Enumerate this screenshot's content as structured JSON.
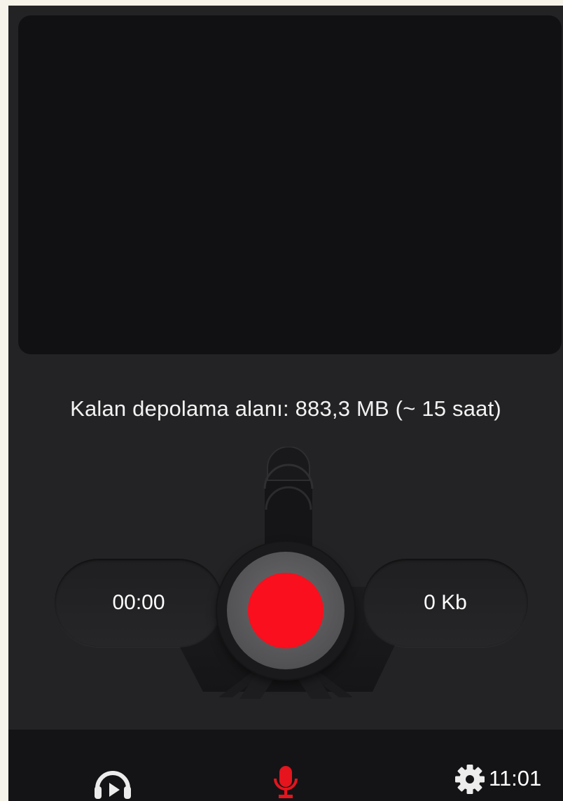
{
  "storage": {
    "text": "Kalan depolama alanı: 883,3 MB (~ 15 saat)"
  },
  "recorder": {
    "elapsed_time": "00:00",
    "file_size": "0 Kb",
    "record_color": "#f90f1d"
  },
  "bottom_nav": {
    "items": [
      {
        "icon": "headphones-play-icon"
      },
      {
        "icon": "microphone-icon",
        "active": true,
        "active_color": "#e5141d"
      },
      {
        "icon": "gear-icon"
      }
    ],
    "time": "11:01"
  }
}
